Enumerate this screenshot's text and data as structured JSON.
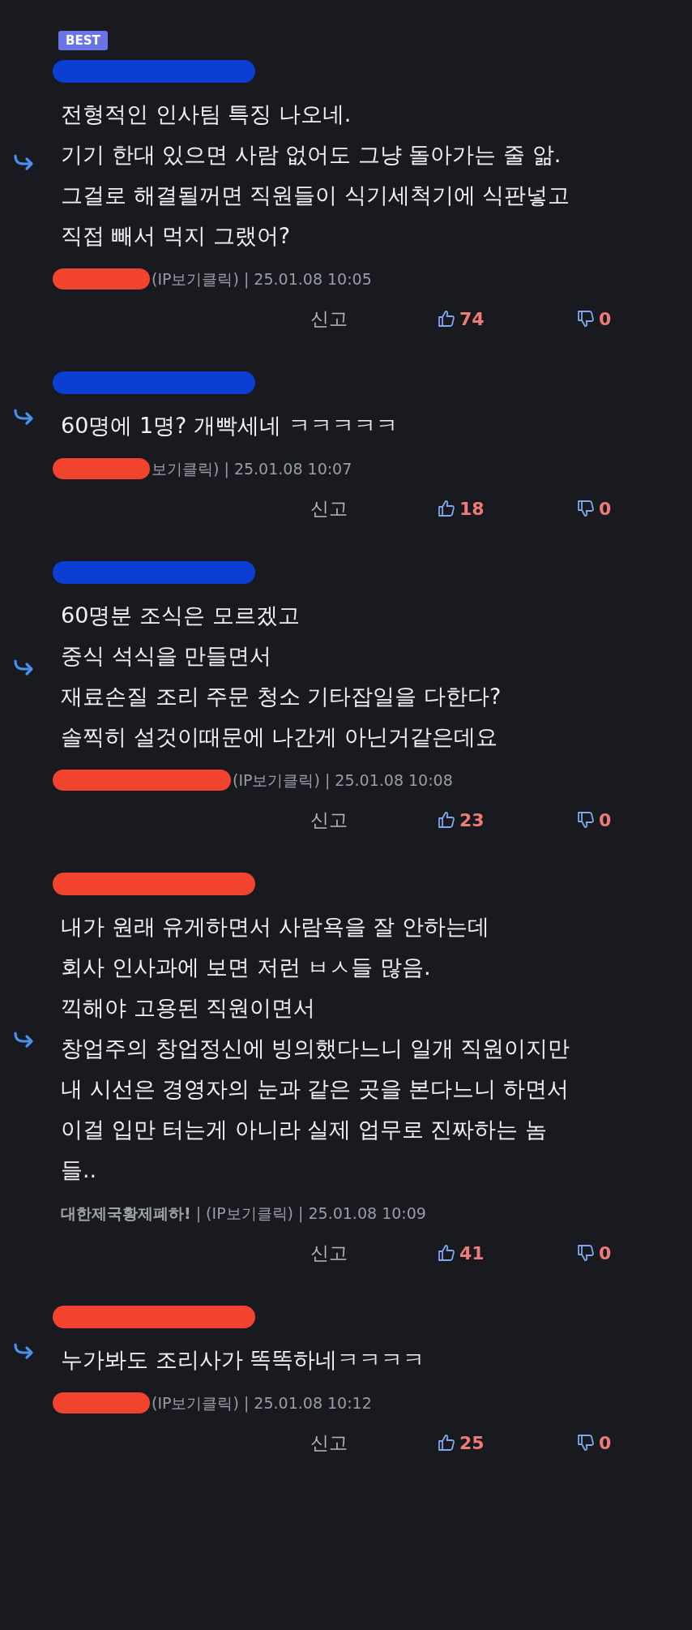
{
  "comments": [
    {
      "badge": "BEST",
      "header_mark": {
        "color": "#0b3fd4"
      },
      "lines": [
        "전형적인 인사팀 특징 나오네.",
        "기기 한대 있으면 사람 없어도 그냥 돌아가는 줄 앎.",
        "그걸로 해결될꺼면 직원들이 식기세척기에 식판넣고",
        "직접 빼서 먹지 그랬어?"
      ],
      "meta_mark": {
        "color": "#f2432f"
      },
      "meta": "(IP보기클릭) | 25.01.08 10:05",
      "report": "신고",
      "likes": "74",
      "dislikes": "0"
    },
    {
      "header_mark": {
        "color": "#0b3fd4"
      },
      "lines": [
        "60명에 1명? 개빡세네 ㅋㅋㅋㅋㅋ"
      ],
      "meta_mark": {
        "color": "#f2432f"
      },
      "meta": "보기클릭) | 25.01.08 10:07",
      "report": "신고",
      "likes": "18",
      "dislikes": "0"
    },
    {
      "header_mark": {
        "color": "#0b3fd4"
      },
      "lines": [
        "60명분 조식은 모르겠고",
        "중식 석식을 만들면서",
        "재료손질 조리 주문 청소 기타잡일을 다한다?",
        "솔찍히 설것이때문에 나간게 아닌거같은데요"
      ],
      "meta_mark": {
        "color": "#f2432f"
      },
      "meta": "(IP보기클릭) | 25.01.08 10:08",
      "report": "신고",
      "likes": "23",
      "dislikes": "0"
    },
    {
      "header_mark": {
        "color": "#f2432f"
      },
      "lines": [
        "내가 원래 유게하면서 사람욕을 잘 안하는데",
        "회사 인사과에 보면 저런 ㅂㅅ들 많음.",
        "끽해야 고용된 직원이면서",
        "창업주의 창업정신에 빙의했다느니 일개 직원이지만",
        "내 시선은 경영자의 눈과 같은 곳을 본다느니 하면서",
        "이걸 입만 터는게 아니라 실제 업무로 진짜하는 놈",
        "들.."
      ],
      "author": "대한제국황제폐하!",
      "meta": "| (IP보기클릭) | 25.01.08 10:09",
      "report": "신고",
      "likes": "41",
      "dislikes": "0"
    },
    {
      "header_mark": {
        "color": "#f2432f"
      },
      "lines": [
        "누가봐도 조리사가 똑똑하네ㅋㅋㅋㅋ"
      ],
      "meta_mark": {
        "color": "#f2432f"
      },
      "meta": "(IP보기클릭) | 25.01.08 10:12",
      "report": "신고",
      "likes": "25",
      "dislikes": "0"
    }
  ]
}
